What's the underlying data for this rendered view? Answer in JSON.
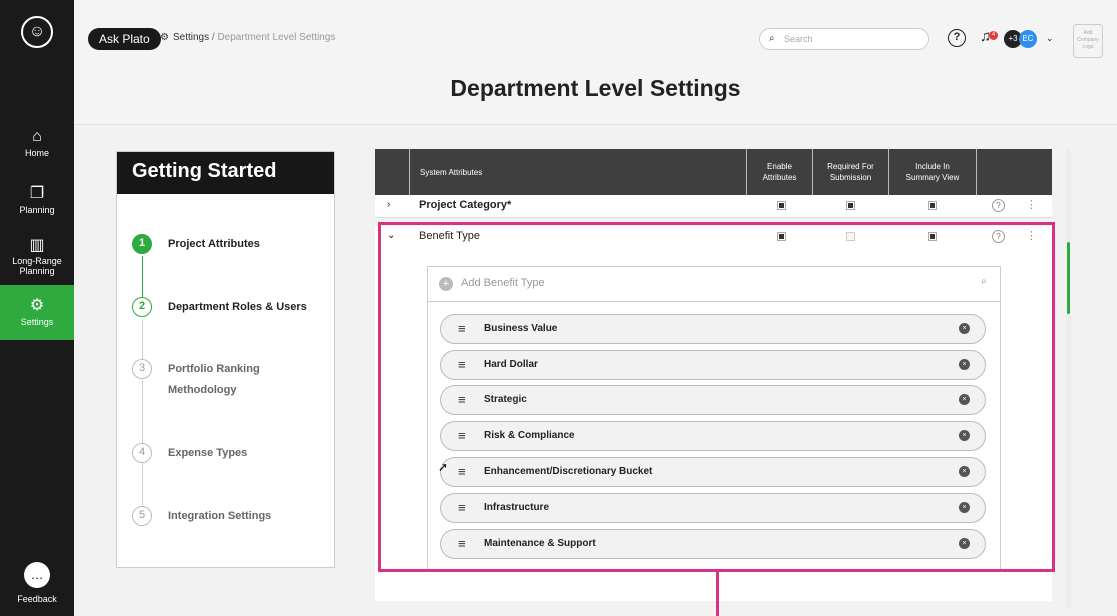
{
  "nav": {
    "items": [
      {
        "label": "Home",
        "icon": "home-icon",
        "glyph": "⌂"
      },
      {
        "label": "Planning",
        "icon": "copy-icon",
        "glyph": "❐"
      },
      {
        "label": "Long-Range Planning",
        "icon": "map-icon",
        "glyph": "▥"
      },
      {
        "label": "Settings",
        "icon": "gear-icon",
        "glyph": "⚙"
      }
    ],
    "feedback_label": "Feedback",
    "active_color": "#2eaa3e"
  },
  "header": {
    "ask_plato": "Ask Plato",
    "breadcrumb_root": "Settings",
    "breadcrumb_sep": "/",
    "breadcrumb_current": "Department Level Settings",
    "search_placeholder": "Search",
    "notification_count": "4",
    "extra_users": "+3",
    "user_initials": "EC",
    "company_logo": "Add Company Logo",
    "page_title": "Department Level Settings"
  },
  "getting_started": {
    "title": "Getting Started",
    "steps": [
      {
        "num": "1",
        "label": "Project Attributes",
        "state": "done"
      },
      {
        "num": "2",
        "label": "Department Roles & Users",
        "state": "current"
      },
      {
        "num": "3",
        "label": "Portfolio Ranking Methodology",
        "state": "todo"
      },
      {
        "num": "4",
        "label": "Expense Types",
        "state": "todo"
      },
      {
        "num": "5",
        "label": "Integration Settings",
        "state": "todo"
      }
    ]
  },
  "table": {
    "headers": {
      "system_attributes": "System Attributes",
      "enable": "Enable Attributes",
      "required": "Required For Submission",
      "summary": "Include In Summary View"
    },
    "rows": [
      {
        "name": "Project Category*",
        "enable": true,
        "required": true,
        "summary": true,
        "expanded": false
      },
      {
        "name": "Benefit Type",
        "enable": true,
        "required": false,
        "summary": true,
        "expanded": true
      }
    ],
    "benefit_type": {
      "add_placeholder": "Add Benefit Type",
      "items": [
        "Business Value",
        "Hard Dollar",
        "Strategic",
        "Risk & Compliance",
        "Enhancement/Discretionary Bucket",
        "Infrastructure",
        "Maintenance & Support"
      ]
    }
  },
  "highlight_color": "#d63384"
}
